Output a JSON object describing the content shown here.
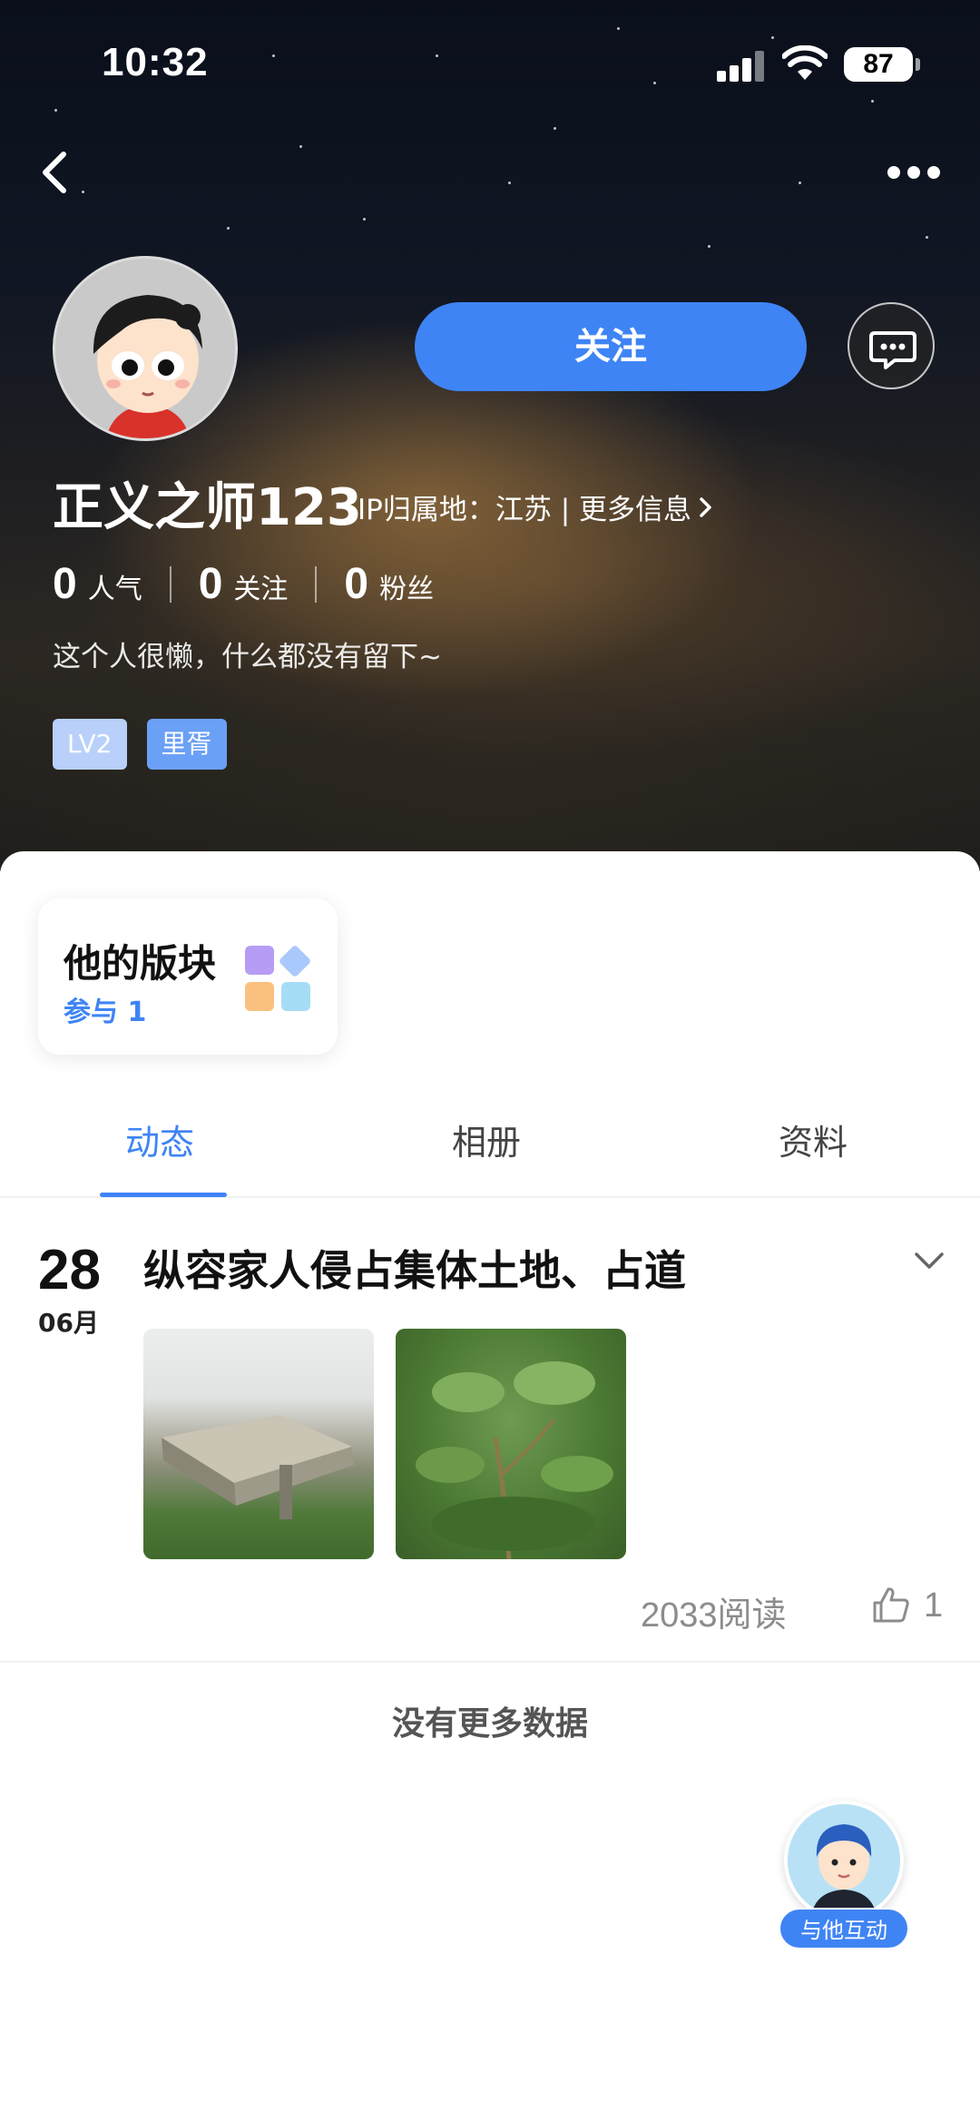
{
  "status_bar": {
    "time": "10:32",
    "battery": "87"
  },
  "profile": {
    "username": "正义之师123",
    "ip_label": "IP归属地：江苏 | 更多信息",
    "follow_label": "关注",
    "stats": [
      {
        "value": "0",
        "label": "人气"
      },
      {
        "value": "0",
        "label": "关注"
      },
      {
        "value": "0",
        "label": "粉丝"
      }
    ],
    "bio": "这个人很懒，什么都没有留下~",
    "tags": [
      "LV2",
      "里胥"
    ]
  },
  "section_card": {
    "title": "他的版块",
    "subtitle": "参与 1"
  },
  "tabs": [
    {
      "label": "动态",
      "active": true
    },
    {
      "label": "相册",
      "active": false
    },
    {
      "label": "资料",
      "active": false
    }
  ],
  "post": {
    "day": "28",
    "month": "06月",
    "title": "纵容家人侵占集体土地、占道",
    "reads": "2033阅读",
    "likes": "1"
  },
  "footer": {
    "no_more": "没有更多数据"
  },
  "interact": {
    "label": "与他互动"
  },
  "colors": {
    "accent": "#3f84f5",
    "tag_light": "#b8d0fa",
    "tag_blue": "#6aa0f6"
  },
  "icons": [
    "back-icon",
    "more-icon",
    "message-icon",
    "chevron-right-icon",
    "chevron-down-icon",
    "grid-icon",
    "thumbs-up-icon"
  ]
}
